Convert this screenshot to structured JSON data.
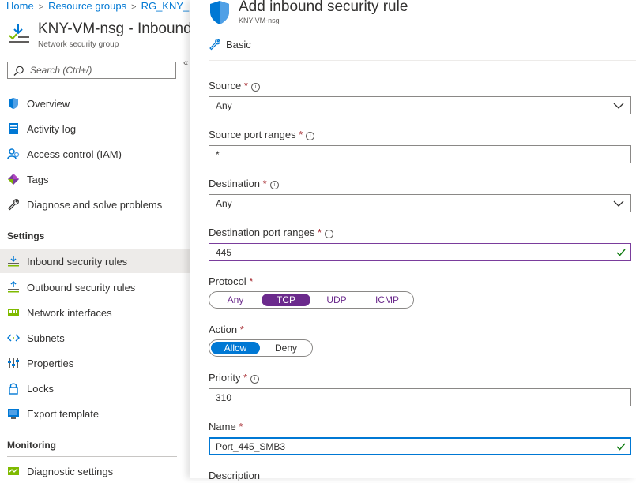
{
  "breadcrumb": [
    "Home",
    "Resource groups",
    "RG_KNY_"
  ],
  "blade": {
    "title": "KNY-VM-nsg - Inbound",
    "subtitle": "Network security group",
    "search_placeholder": "Search (Ctrl+/)",
    "collapse_glyph": "«"
  },
  "nav": {
    "overview": "Overview",
    "activity_log": "Activity log",
    "iam": "Access control (IAM)",
    "tags": "Tags",
    "diagnose": "Diagnose and solve problems",
    "settings_header": "Settings",
    "inbound": "Inbound security rules",
    "outbound": "Outbound security rules",
    "network_interfaces": "Network interfaces",
    "subnets": "Subnets",
    "properties": "Properties",
    "locks": "Locks",
    "export_template": "Export template",
    "monitoring_header": "Monitoring",
    "diagnostic_settings": "Diagnostic settings"
  },
  "panel": {
    "title": "Add inbound security rule",
    "subtitle": "KNY-VM-nsg",
    "basic_label": "Basic",
    "source_label": "Source",
    "source_value": "Any",
    "source_port_label": "Source port ranges",
    "source_port_value": "*",
    "destination_label": "Destination",
    "destination_value": "Any",
    "dest_port_label": "Destination port ranges",
    "dest_port_value": "445",
    "protocol_label": "Protocol",
    "protocol_options": [
      "Any",
      "TCP",
      "UDP",
      "ICMP"
    ],
    "protocol_selected": "TCP",
    "action_label": "Action",
    "action_options": [
      "Allow",
      "Deny"
    ],
    "action_selected": "Allow",
    "priority_label": "Priority",
    "priority_value": "310",
    "name_label": "Name",
    "name_value": "Port_445_SMB3",
    "description_label": "Description",
    "required_mark": "*",
    "info_glyph": "i"
  },
  "colors": {
    "link": "#0078d4",
    "accent_purple": "#6b2a8c",
    "allow_blue": "#0078d4",
    "valid_green": "#107c10",
    "required_red": "#a4262c"
  }
}
